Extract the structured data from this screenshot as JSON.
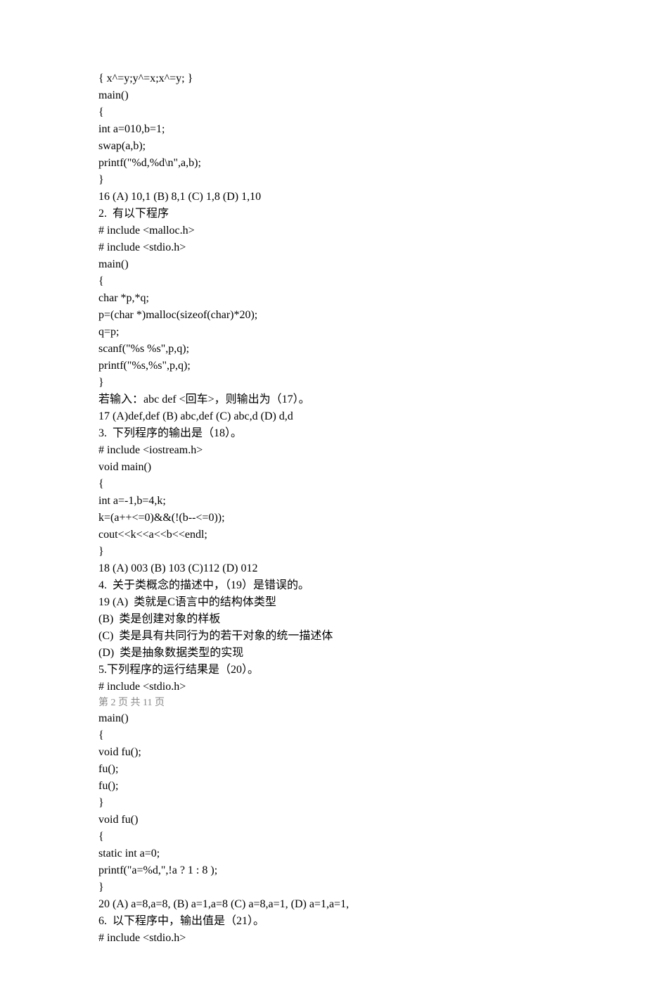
{
  "lines": [
    "{ x^=y;y^=x;x^=y; }",
    "main()",
    "{",
    "int a=010,b=1;",
    "swap(a,b);",
    "printf(\"%d,%d\\n\",a,b);",
    "}",
    "16 (A) 10,1 (B) 8,1 (C) 1,8 (D) 1,10",
    "2.  有以下程序",
    "# include <malloc.h>",
    "# include <stdio.h>",
    "main()",
    "{",
    "char *p,*q;",
    "p=(char *)malloc(sizeof(char)*20);",
    "q=p;",
    "scanf(\"%s %s\",p,q);",
    "printf(\"%s,%s\",p,q);",
    "}",
    "若输入：abc def <回车>，则输出为（17）。",
    "17 (A)def,def (B) abc,def (C) abc,d (D) d,d",
    "3.  下列程序的输出是（18）。",
    "# include <iostream.h>",
    "void main()",
    "{",
    "int a=-1,b=4,k;",
    "k=(a++<=0)&&(!(b--<=0));",
    "cout<<k<<a<<b<<endl;",
    "}",
    "18 (A) 003 (B) 103 (C)112 (D) 012",
    "4.  关于类概念的描述中，（19）是错误的。",
    "19 (A)  类就是C语言中的结构体类型",
    "(B)  类是创建对象的样板",
    "(C)  类是具有共同行为的若干对象的统一描述体",
    "(D)  类是抽象数据类型的实现",
    "5.下列程序的运行结果是（20）。",
    "# include <stdio.h>"
  ],
  "page_indicator": "第 2 页 共 11 页",
  "lines_after": [
    "main()",
    "{",
    "void fu();",
    "fu();",
    "fu();",
    "}",
    "void fu()",
    "{",
    "static int a=0;",
    "printf(\"a=%d,\",!a ? 1 : 8 );",
    "}",
    "20 (A) a=8,a=8, (B) a=1,a=8 (C) a=8,a=1, (D) a=1,a=1,",
    "6.  以下程序中，输出值是（21）。",
    "# include <stdio.h>"
  ]
}
